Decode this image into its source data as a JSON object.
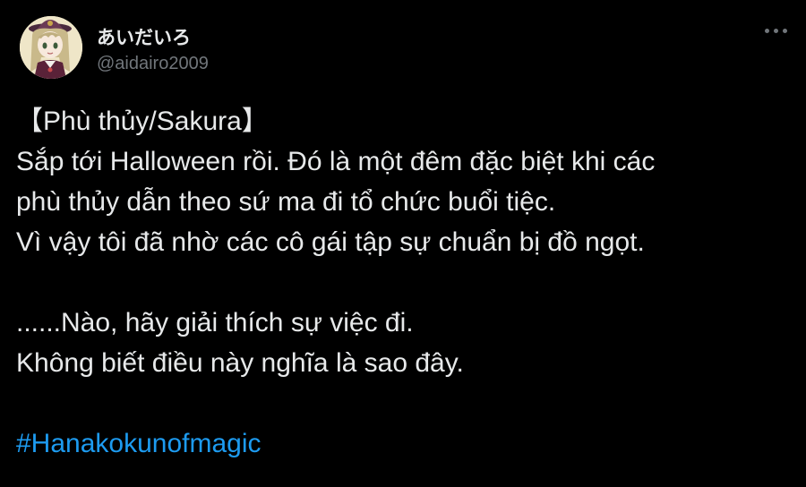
{
  "author": {
    "display_name": "あいだいろ",
    "handle": "@aidairo2009",
    "avatar_icon": "avatar-image"
  },
  "more_menu": {
    "icon": "more-horizontal-icon"
  },
  "tweet": {
    "lines": [
      "【Phù thủy/Sakura】",
      "Sắp tới Halloween rồi. Đó là một đêm đặc biệt khi các",
      "phù thủy dẫn theo sứ ma đi tổ chức buổi tiệc.",
      "Vì vậy tôi đã nhờ các cô gái tập sự chuẩn bị đồ ngọt.",
      "",
      "......Nào, hãy giải thích sự việc đi.",
      "Không biết điều này nghĩa là sao đây.",
      ""
    ],
    "hashtag": "#Hanakokunofmagic"
  },
  "colors": {
    "background": "#000000",
    "text": "#e7e9ea",
    "secondary": "#71767b",
    "link": "#1d9bf0"
  }
}
